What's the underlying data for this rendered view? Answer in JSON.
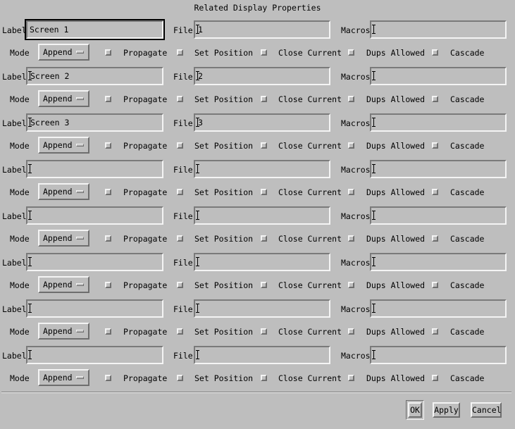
{
  "window": {
    "title": "Related Display Properties"
  },
  "labels": {
    "label": "Label",
    "file": "File",
    "macros": "Macros",
    "mode": "Mode",
    "propagate": "Propagate",
    "set_position": "Set Position",
    "close_current": "Close Current",
    "dups_allowed": "Dups Allowed",
    "cascade": "Cascade"
  },
  "entries": [
    {
      "label": "Screen 1",
      "file": "1",
      "macros": "",
      "mode": "Append"
    },
    {
      "label": "Screen 2",
      "file": "2",
      "macros": "",
      "mode": "Append"
    },
    {
      "label": "Screen 3",
      "file": "3",
      "macros": "",
      "mode": "Append"
    },
    {
      "label": "",
      "file": "",
      "macros": "",
      "mode": "Append"
    },
    {
      "label": "",
      "file": "",
      "macros": "",
      "mode": "Append"
    },
    {
      "label": "",
      "file": "",
      "macros": "",
      "mode": "Append"
    },
    {
      "label": "",
      "file": "",
      "macros": "",
      "mode": "Append"
    },
    {
      "label": "",
      "file": "",
      "macros": "",
      "mode": "Append"
    }
  ],
  "buttons": {
    "ok": "OK",
    "apply": "Apply",
    "cancel": "Cancel"
  }
}
